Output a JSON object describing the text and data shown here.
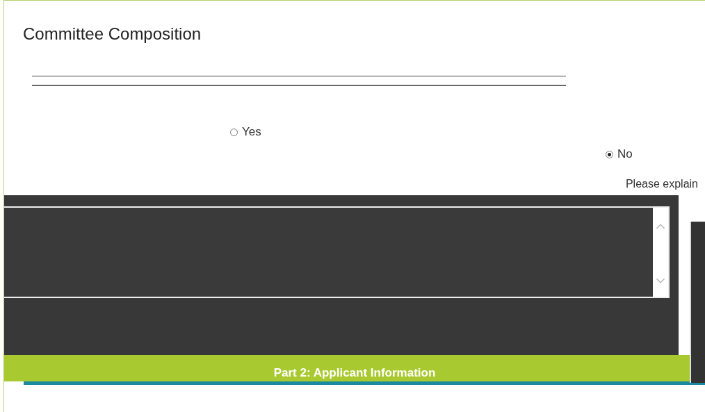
{
  "section": {
    "title": "Committee Composition"
  },
  "question": {
    "options": [
      {
        "label": "Yes",
        "selected": false
      },
      {
        "label": "No",
        "selected": true
      }
    ]
  },
  "explain": {
    "label": "Please explain"
  },
  "next_section": {
    "title": "Part 2: Applicant Information"
  }
}
